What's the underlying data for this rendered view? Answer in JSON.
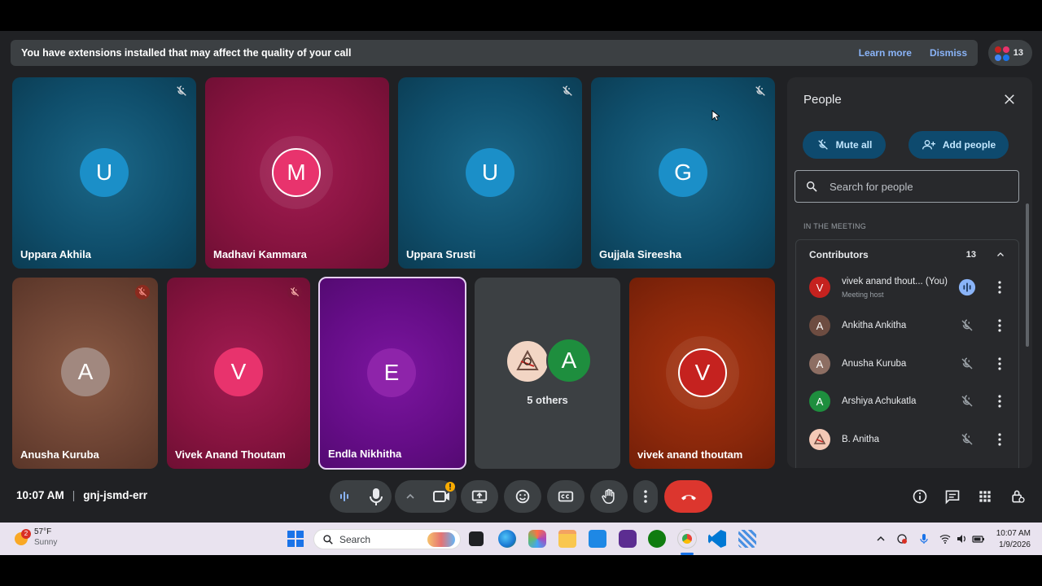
{
  "banner": {
    "message": "You have extensions installed that may affect the quality of your call",
    "learn_more": "Learn more",
    "dismiss": "Dismiss"
  },
  "participant_count": "13",
  "tiles": [
    {
      "name": "Uppara Akhila",
      "initial": "U"
    },
    {
      "name": "Madhavi Kammara",
      "initial": "M"
    },
    {
      "name": "Uppara Srusti",
      "initial": "U"
    },
    {
      "name": "Gujjala Sireesha",
      "initial": "G"
    },
    {
      "name": "Anusha Kuruba",
      "initial": "A"
    },
    {
      "name": "Vivek Anand Thoutam",
      "initial": "V"
    },
    {
      "name": "Endla Nikhitha",
      "initial": "E"
    },
    {
      "name": "5 others",
      "initial": "A"
    },
    {
      "name": "vivek anand thoutam",
      "initial": "V"
    }
  ],
  "people": {
    "title": "People",
    "mute_all": "Mute all",
    "add_people": "Add people",
    "search_placeholder": "Search for people",
    "section": "IN THE MEETING",
    "contributors_label": "Contributors",
    "contributors_count": "13",
    "list": [
      {
        "initial": "V",
        "name": "vivek anand thout...  (You)",
        "sub": "Meeting host",
        "color": "#c5221f"
      },
      {
        "initial": "A",
        "name": "Ankitha Ankitha",
        "sub": "",
        "color": "#6d4c41"
      },
      {
        "initial": "A",
        "name": "Anusha Kuruba",
        "sub": "",
        "color": "#8d6e63"
      },
      {
        "initial": "A",
        "name": "Arshiya Achukatla",
        "sub": "",
        "color": "#1e8e3e"
      },
      {
        "initial": "",
        "name": "B. Anitha",
        "sub": "",
        "color": "#f4c9b6"
      }
    ]
  },
  "meeting": {
    "time": "10:07 AM",
    "code": "gnj-jsmd-err"
  },
  "taskbar": {
    "temperature": "57°F",
    "weather": "Sunny",
    "weather_badge": "2",
    "search": "Search",
    "time": "10:07 AM",
    "date": "1/9/2026"
  },
  "colors": {
    "accent": "#8ab4f8",
    "hangup": "#dc362e",
    "panel_button": "#0e4a6e"
  }
}
